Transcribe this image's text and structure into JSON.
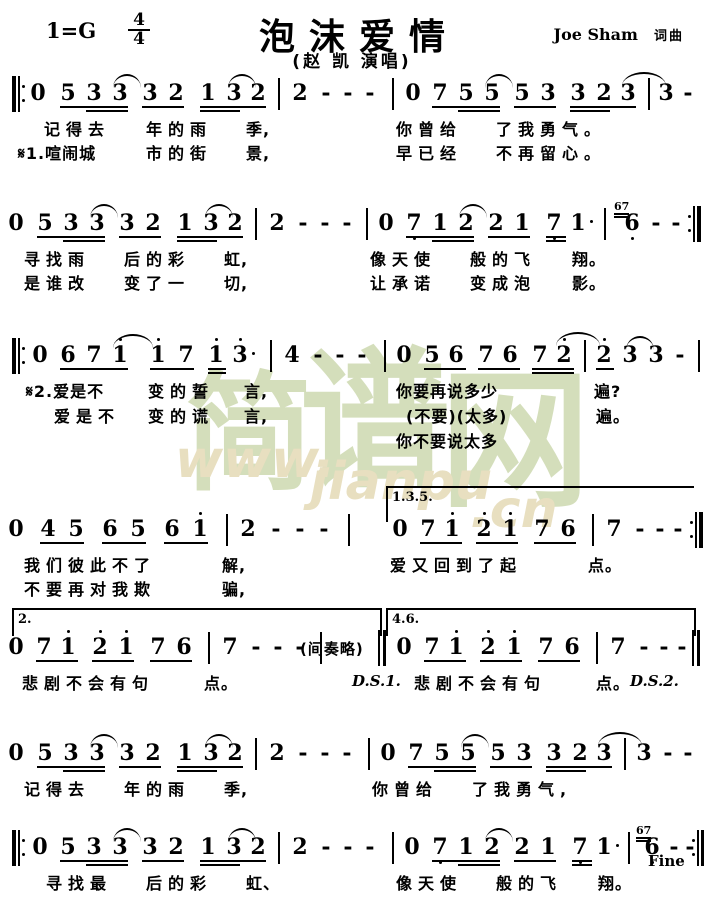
{
  "header": {
    "key_signature": "1=G",
    "meter_num": "4",
    "meter_den": "4",
    "title": "泡沫爱情",
    "subtitle": "(赵 凯 演唱)",
    "credit_name": "Joe Sham",
    "credit_role": "词曲"
  },
  "watermark": {
    "chinese": "简谱网",
    "url": "www.jianpu.cn"
  },
  "staves": [
    {
      "id": "stave-1",
      "notes_left": "0 5 3 3 3 2 1 3 2 | 2 - - -",
      "notes_right": "0 7 5 5 5 3 3 2 3 | 3 - - -",
      "lyrics": [
        {
          "segments": [
            "记得去",
            "年的雨",
            "季,"
          ]
        },
        {
          "segments": [
            "𝄋1.喧闹城",
            "市的街",
            "景,"
          ]
        }
      ]
    },
    {
      "id": "stave-2",
      "notes_left": "0 5 3 3 3 2 1 3 2 | 2 - - -",
      "notes_right": "0 7 1 2 2 1 7 1. | 6 - - -",
      "grace": "67",
      "lyrics": [
        {
          "segments": [
            "寻找雨",
            "后的彩",
            "虹,"
          ]
        },
        {
          "segments": [
            "是谁改",
            "变了一",
            "切,"
          ]
        },
        {
          "segments": [
            "像天使",
            "般的飞",
            "翔。"
          ]
        },
        {
          "segments": [
            "让承诺",
            "变成泡",
            "影。"
          ]
        }
      ]
    },
    {
      "id": "stave-3",
      "notes_left": "0 6 7 1 1 7 1 3. | 4 - - -",
      "notes_right": "0 5 6 7 6 7 2 | 2 3 3 - -",
      "lyrics": [
        {
          "segments": [
            "𝄋2.爱是不",
            "变的誓",
            "言,"
          ]
        },
        {
          "segments": [
            "爱是不",
            "变的谎",
            "言,"
          ]
        },
        {
          "segments": [
            "你要再说多少",
            "遍?"
          ]
        },
        {
          "segments": [
            "(不要)(太多)",
            "遍。"
          ]
        },
        {
          "segments": [
            "你不要说太多"
          ]
        }
      ]
    },
    {
      "id": "stave-4",
      "volta_label": "1.3.5.",
      "notes_left": "0 4 5 6 5 6 1 | 2 - - -",
      "notes_right": "0 7 1 2 1 7 6 | 7 - - -",
      "lyrics": [
        {
          "segments": [
            "我们彼此不了",
            "解,"
          ]
        },
        {
          "segments": [
            "不要再对我欺",
            "骗,"
          ]
        },
        {
          "segments": [
            "爱又回到了起",
            "点。"
          ]
        }
      ]
    },
    {
      "id": "stave-5",
      "volta_label_left": "2.",
      "volta_label_right": "4.6.",
      "notes_left": "0 7 1 2 1 7 6 | 7 - - -",
      "notes_right": "0 7 1 2 1 7 6 | 7 - - -",
      "interlude": "(间奏略)",
      "ds_left": "D.S.1.",
      "ds_right": "D.S.2.",
      "lyrics": [
        {
          "segments": [
            "悲剧不会有句",
            "点。"
          ]
        },
        {
          "segments": [
            "悲剧不会有句",
            "点。"
          ]
        }
      ]
    },
    {
      "id": "stave-6",
      "notes_left": "0 5 3 3 3 2 1 3 2 | 2 - - -",
      "notes_right": "0 7 5 5 5 3 3 2 3 | 3 - - -",
      "lyrics": [
        {
          "segments": [
            "记得去",
            "年的雨",
            "季,"
          ]
        },
        {
          "segments": [
            "你曾给",
            "了我勇气,"
          ]
        }
      ]
    },
    {
      "id": "stave-7",
      "notes_left": "0 5 3 3 3 2 1 3 2 | 2 - - -",
      "notes_right": "0 7 1 2 2 1 7 1. | 6 - - -",
      "grace": "67",
      "end_mark": "Fine",
      "lyrics": [
        {
          "segments": [
            "寻找最",
            "后的彩",
            "虹、"
          ]
        },
        {
          "segments": [
            "像天使",
            "般的飞",
            "翔。"
          ]
        }
      ]
    }
  ],
  "lyric_lines": {
    "s1a1": "记得去",
    "s1a2": "年的雨",
    "s1a3": "季,",
    "s1b1": "1.喧闹城",
    "s1b2": "市的街",
    "s1b3": "景,",
    "s1c1": "你曾给",
    "s1c2": "了我勇气。",
    "s1d1": "早已经",
    "s1d2": "不再留心。",
    "s2a1": "寻找雨",
    "s2a2": "后的彩",
    "s2a3": "虹,",
    "s2b1": "是谁改",
    "s2b2": "变了一",
    "s2b3": "切,",
    "s2c1": "像天使",
    "s2c2": "般的飞",
    "s2c3": "翔。",
    "s2d1": "让承诺",
    "s2d2": "变成泡",
    "s2d3": "影。",
    "s3a1": "2.爱是不",
    "s3a2": "变的誓",
    "s3a3": "言,",
    "s3b1": "爱是不",
    "s3b2": "变的谎",
    "s3b3": "言,",
    "s3c1": "你要再说多少",
    "s3c2": "遍?",
    "s3d1": "(不要)(太多)",
    "s3d2": "遍。",
    "s3e1": "你不要说太多",
    "s4a1": "我们彼此不了",
    "s4a2": "解,",
    "s4b1": "不要再对我欺",
    "s4b2": "骗,",
    "s4c1": "爱又回到了起",
    "s4c2": "点。",
    "s5a1": "悲剧不会有句",
    "s5a2": "点。",
    "s5b1": "悲剧不会有句",
    "s5b2": "点。",
    "s6a1": "记得去",
    "s6a2": "年的雨",
    "s6a3": "季,",
    "s6b1": "你曾给",
    "s6b2": "了我勇气,",
    "s7a1": "寻找最",
    "s7a2": "后的彩",
    "s7a3": "虹、",
    "s7b1": "像天使",
    "s7b2": "般的飞",
    "s7b3": "翔。"
  },
  "symbols": {
    "segno": "𝄋",
    "interlude": "(间奏略)",
    "ds1": "D.S.1.",
    "ds2": "D.S.2.",
    "fine": "Fine",
    "grace_67": "67",
    "volta_135": "1.3.5.",
    "volta_2": "2.",
    "volta_46": "4.6.",
    "rest": "0",
    "dash": "-"
  },
  "notes": {
    "n0": "0",
    "n1": "1",
    "n2": "2",
    "n3": "3",
    "n4": "4",
    "n5": "5",
    "n6": "6",
    "n7": "7",
    "dash": "-",
    "dot": "."
  }
}
